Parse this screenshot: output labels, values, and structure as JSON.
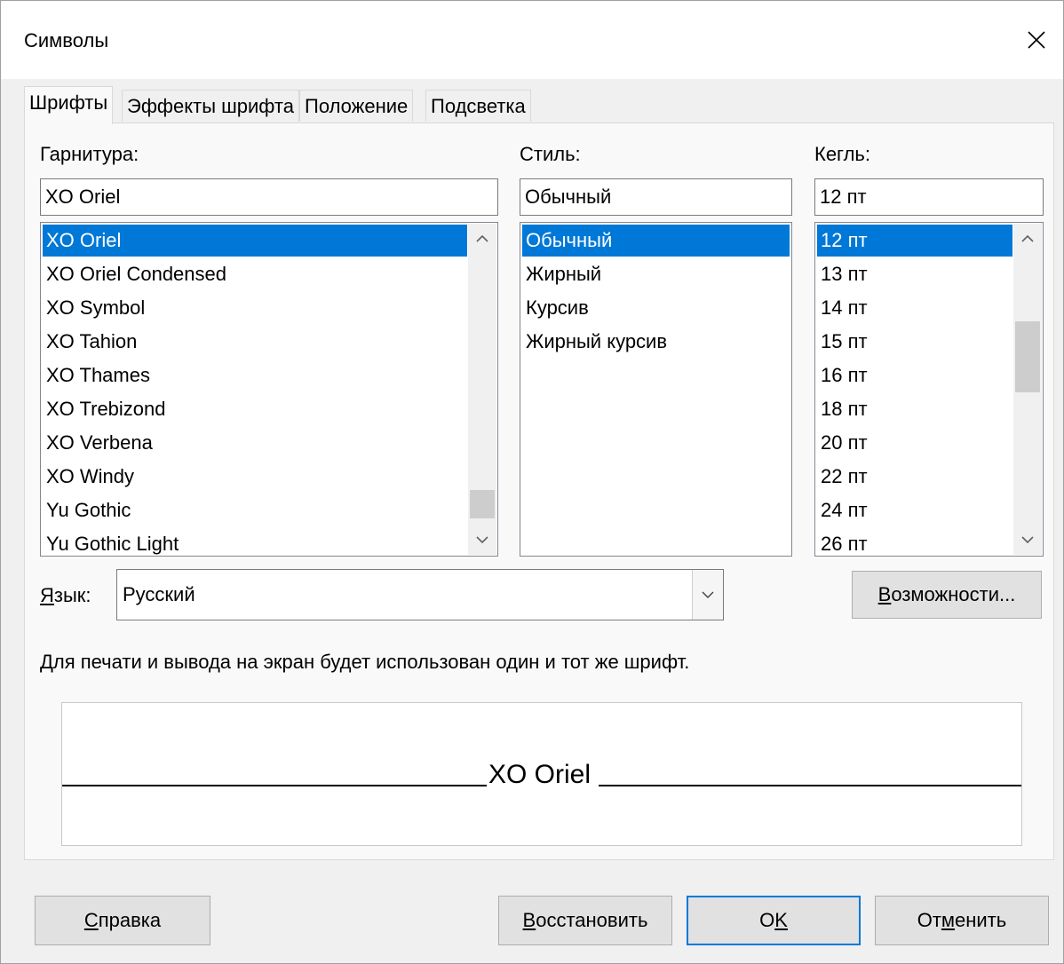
{
  "window": {
    "title": "Символы",
    "close_glyph": "✕"
  },
  "tabs": [
    {
      "label": "Шрифты",
      "active": true
    },
    {
      "label": "Эффекты шрифта",
      "active": false
    },
    {
      "label": "Положение",
      "active": false
    },
    {
      "label": "Подсветка",
      "active": false
    }
  ],
  "typeface": {
    "label": "Гарнитура:",
    "value": "XO Oriel",
    "items": [
      "XO Oriel",
      "XO Oriel Condensed",
      "XO Symbol",
      "XO Tahion",
      "XO Thames",
      "XO Trebizond",
      "XO Verbena",
      "XO Windy",
      "Yu Gothic",
      "Yu Gothic Light"
    ],
    "selected_index": 0,
    "scroll_position": 0.95
  },
  "style": {
    "label": "Стиль:",
    "value": "Обычный",
    "items": [
      "Обычный",
      "Жирный",
      "Курсив",
      "Жирный курсив"
    ],
    "selected_index": 0
  },
  "size": {
    "label": "Кегль:",
    "value": "12 пт",
    "items": [
      "12 пт",
      "13 пт",
      "14 пт",
      "15 пт",
      "16 пт",
      "18 пт",
      "20 пт",
      "22 пт",
      "24 пт",
      "26 пт"
    ],
    "selected_index": 0,
    "scroll_position": 0.3
  },
  "language": {
    "label_first": "Я",
    "label_rest": "зык:",
    "value": "Русский"
  },
  "features_button": {
    "u": "В",
    "rest": "озможности..."
  },
  "info_text": "Для печати и вывода на экран будет использован один и тот же шрифт.",
  "preview": {
    "text": "XO Oriel"
  },
  "buttons": {
    "help": {
      "u": "С",
      "rest": "правка"
    },
    "reset": {
      "u": "В",
      "rest": "осстановить"
    },
    "ok": {
      "pre": "O",
      "u": "K",
      "rest": ""
    },
    "cancel": {
      "pre": "От",
      "u": "м",
      "rest": "енить"
    }
  },
  "colors": {
    "selection": "#0078d7",
    "default_button_border": "#0078d7"
  }
}
